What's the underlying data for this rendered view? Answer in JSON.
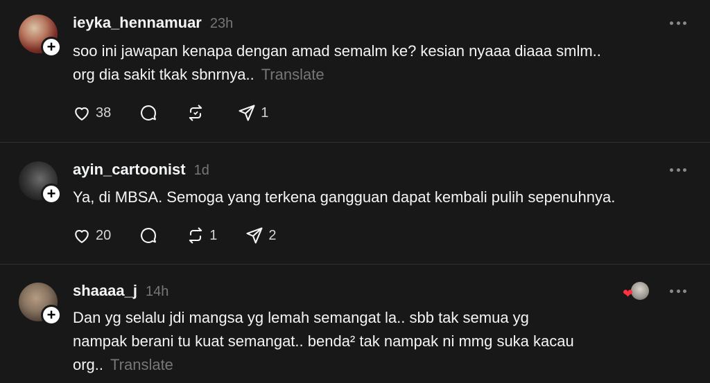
{
  "posts": [
    {
      "username": "ieyka_hennamuar",
      "time": "23h",
      "lines": [
        "soo ini jawapan kenapa dengan amad semalm ke? kesian nyaaa diaaa smlm..",
        "org dia sakit tkak sbnrnya.."
      ],
      "translate": "Translate",
      "likes": "38",
      "reposts": "",
      "shares": "1"
    },
    {
      "username": "ayin_cartoonist",
      "time": "1d",
      "lines": [
        "Ya, di MBSA. Semoga yang terkena gangguan dapat kembali pulih sepenuhnya."
      ],
      "likes": "20",
      "reposts": "1",
      "shares": "2"
    },
    {
      "username": "shaaaa_j",
      "time": "14h",
      "lines": [
        "Dan yg selalu jdi mangsa yg lemah semangat la.. sbb tak semua yg",
        "nampak berani tu kuat semangat.. benda² tak nampak ni mmg suka kacau",
        "org.."
      ],
      "translate": "Translate",
      "reaction_icon": "heart-icon"
    }
  ],
  "icons": {
    "like": "heart-outline-icon",
    "reply": "comment-bubble-icon",
    "repost": "repost-arrows-icon",
    "share": "send-paper-plane-icon",
    "more": "more-horizontal-icon",
    "follow": "plus-icon"
  },
  "colors": {
    "background": "#181818",
    "text": "#f3f5f7",
    "muted": "#777777",
    "divider": "#323232"
  }
}
